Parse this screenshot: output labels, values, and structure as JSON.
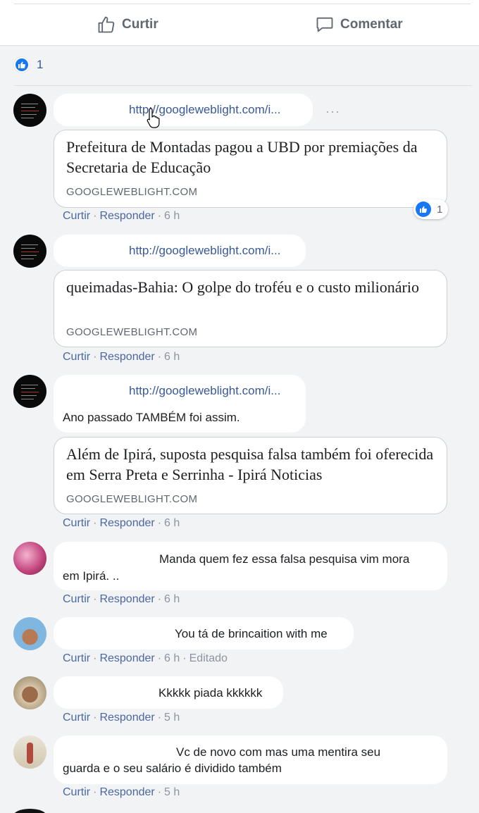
{
  "actions": {
    "like_label": "Curtir",
    "comment_label": "Comentar"
  },
  "reactions": {
    "count": "1"
  },
  "comments": [
    {
      "link": "http://googleweblight.com/i...",
      "card": {
        "title": "Prefeitura de Montadas pagou a UBD por premiações da Secretaria de Educação",
        "domain": "GOOGLEWEBLIGHT.COM"
      },
      "meta": {
        "like": "Curtir",
        "reply": "Responder",
        "time": "6 h"
      },
      "reaction_count": "1"
    },
    {
      "link": "http://googleweblight.com/i...",
      "card": {
        "title": "queimadas-Bahia: O golpe do troféu e o custo milionário",
        "domain": "GOOGLEWEBLIGHT.COM"
      },
      "meta": {
        "like": "Curtir",
        "reply": "Responder",
        "time": "6 h"
      }
    },
    {
      "link": "http://googleweblight.com/i...",
      "text": "Ano passado TAMBÉM foi assim.",
      "card": {
        "title": "Além de Ipirá, suposta pesquisa falsa também foi oferecida em Serra Preta e Serrinha - Ipirá Noticias",
        "domain": "GOOGLEWEBLIGHT.COM"
      },
      "meta": {
        "like": "Curtir",
        "reply": "Responder",
        "time": "6 h"
      }
    },
    {
      "text_line1": "Manda quem fez essa falsa pesquisa vim mora",
      "text_line2": "em Ipirá. ..",
      "meta": {
        "like": "Curtir",
        "reply": "Responder",
        "time": "6 h"
      }
    },
    {
      "text": "You tá de brincaition with me",
      "meta": {
        "like": "Curtir",
        "reply": "Responder",
        "time": "6 h",
        "edited": "Editado"
      }
    },
    {
      "text": "Kkkkk piada kkkkkk",
      "meta": {
        "like": "Curtir",
        "reply": "Responder",
        "time": "5 h"
      }
    },
    {
      "text_line1": "Vc de novo com mas uma mentira seu",
      "text_line2": "guarda e o seu salário é dividido também",
      "meta": {
        "like": "Curtir",
        "reply": "Responder",
        "time": "5 h"
      }
    }
  ],
  "colors": {
    "link": "#385898",
    "meta_action": "#4b67a1",
    "like_blue": "#1877f2",
    "background": "#f2f3f5"
  }
}
